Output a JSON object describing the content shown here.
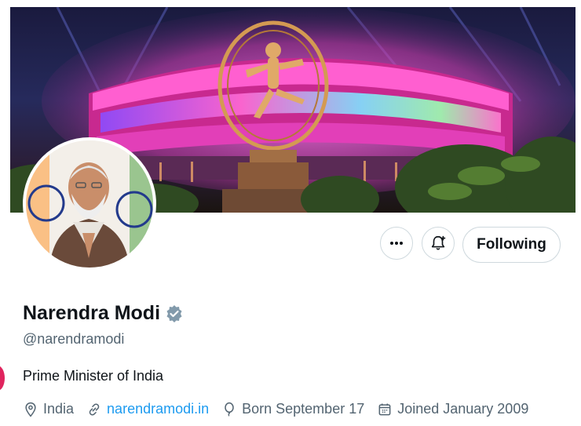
{
  "profile": {
    "name": "Narendra Modi",
    "handle": "@narendramodi",
    "bio": "Prime Minister of India",
    "location": "India",
    "website": "narendramodi.in",
    "birthday": "Born September 17",
    "joined": "Joined January 2009"
  },
  "actions": {
    "more_label": "•••",
    "follow_label": "Following"
  },
  "icons": {
    "more": "more-icon",
    "notify": "bell-plus-icon",
    "verified": "verified-badge-icon",
    "location": "location-pin-icon",
    "link": "link-icon",
    "birthday": "balloon-icon",
    "joined": "calendar-icon"
  },
  "colors": {
    "accent": "#1d9bf0",
    "secondary_text": "#536471",
    "primary_text": "#0f1419",
    "banner_glow": "#e040c8"
  }
}
